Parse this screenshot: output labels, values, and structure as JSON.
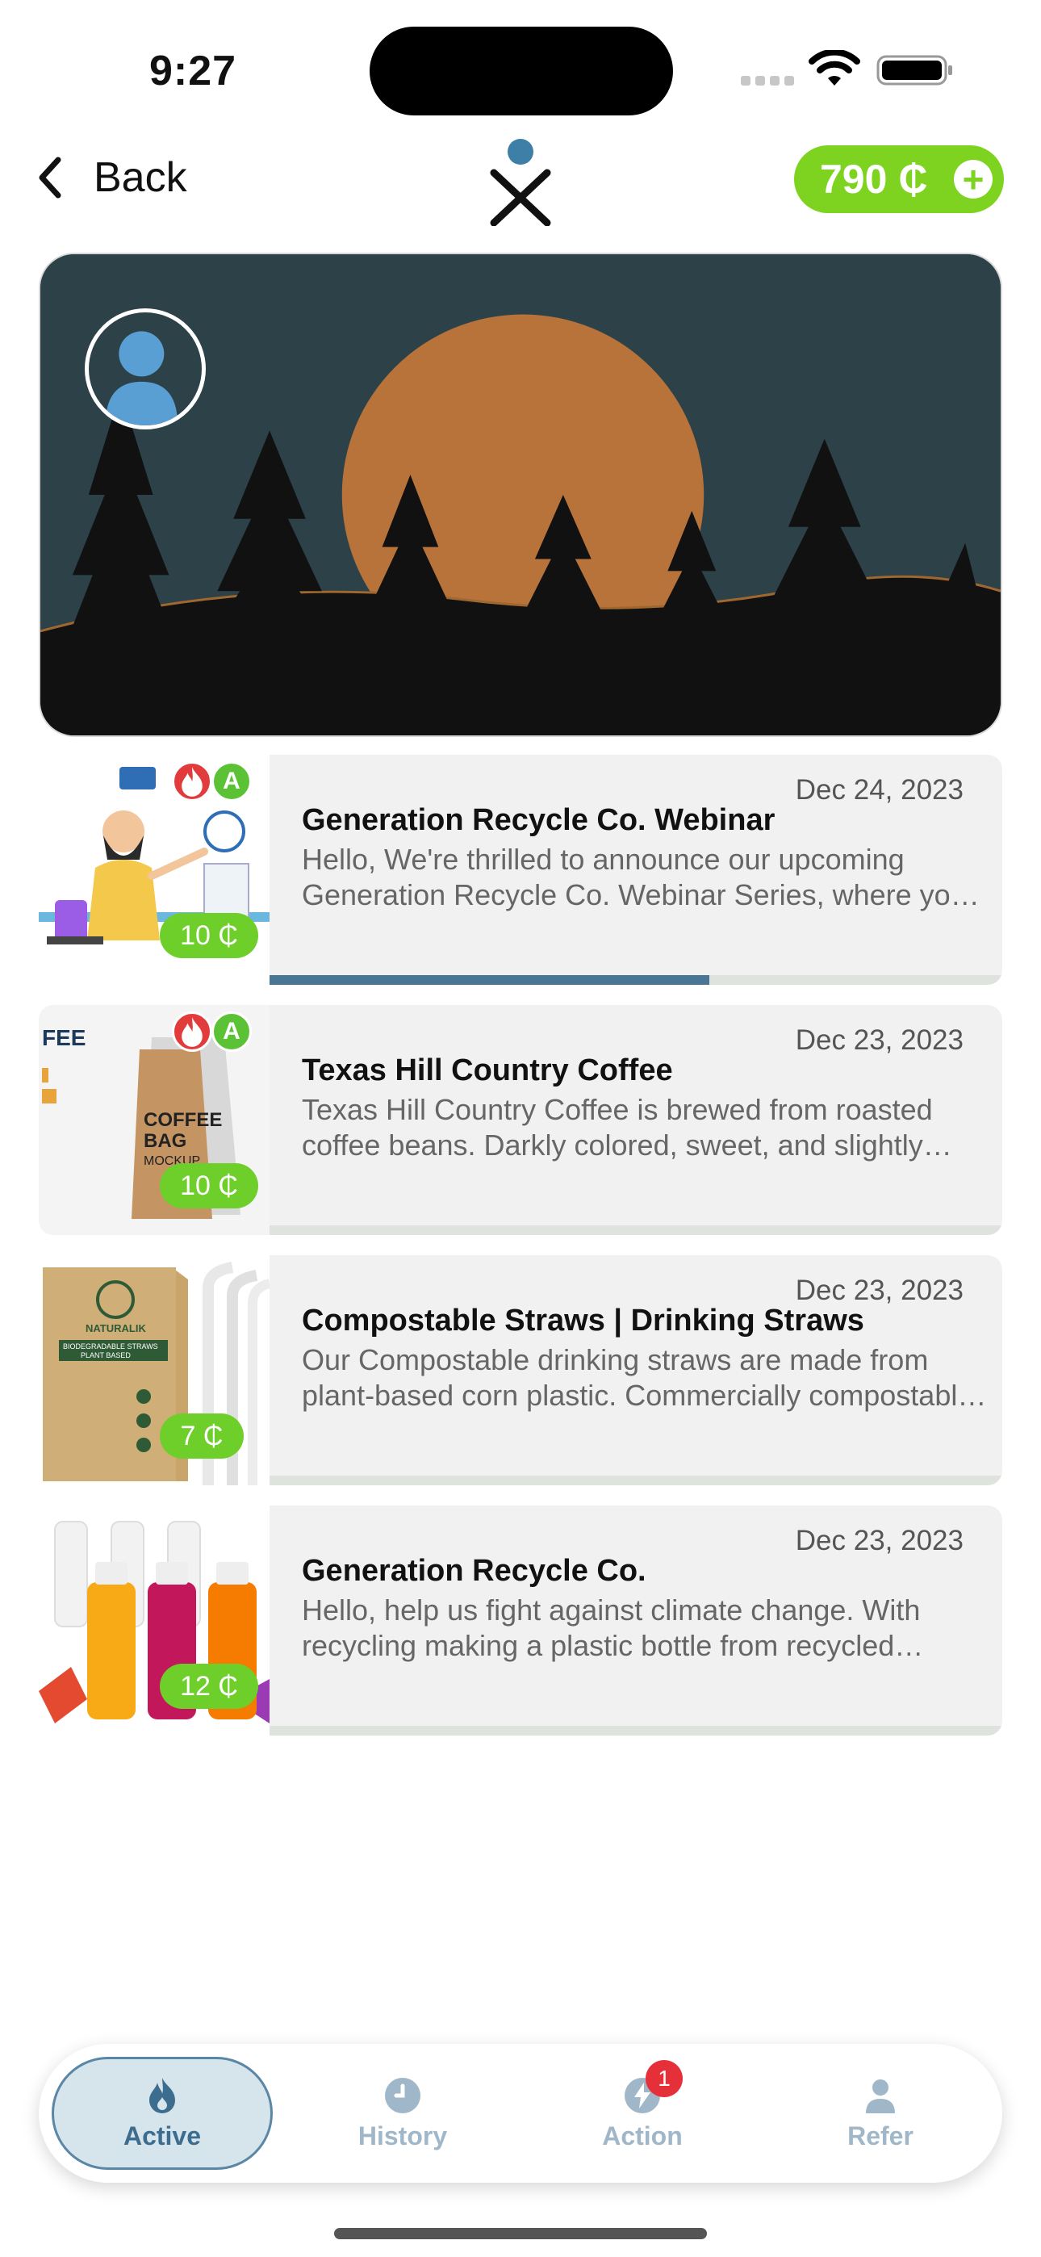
{
  "status_bar": {
    "time": "9:27"
  },
  "header": {
    "back_label": "Back",
    "credits": "790 ₵"
  },
  "feed": [
    {
      "date": "Dec 24, 2023",
      "title": "Generation Recycle Co. Webinar",
      "description": "Hello, We're thrilled to announce our upcoming Generation Recycle Co. Webinar Series, where you'll learn more.",
      "reward": "10 ₵",
      "progress": 0.6,
      "badges": [
        "flame",
        "A"
      ]
    },
    {
      "date": "Dec 23, 2023",
      "title": "Texas Hill Country Coffee",
      "description": "Texas Hill Country Coffee is brewed from roasted coffee beans. Darkly colored, sweet, and slightly bitter.",
      "reward": "10 ₵",
      "progress": 0,
      "badges": [
        "flame",
        "A"
      ],
      "thumb_text": [
        "FEE",
        "COFFEE",
        "BAG",
        "MOCKUP"
      ]
    },
    {
      "date": "Dec 23, 2023",
      "title": "Compostable Straws | Drinking Straws",
      "description": "Our Compostable drinking straws are made from plant-based corn plastic. Commercially compostable and sustainable.",
      "reward": "7 ₵",
      "progress": 0,
      "thumb_text": [
        "NATURALIK",
        "BIODEGRADABLE STRAWS",
        "PLANT BASED"
      ]
    },
    {
      "date": "Dec 23, 2023",
      "title": "Generation Recycle Co.",
      "description": "Hello, help us fight against climate change. With recycling making a plastic bottle from recycled plastic.",
      "reward": "12 ₵",
      "progress": 0
    }
  ],
  "tabs": [
    {
      "label": "Active",
      "icon": "flame-icon",
      "active": true
    },
    {
      "label": "History",
      "icon": "clock-icon",
      "active": false
    },
    {
      "label": "Action",
      "icon": "bolt-icon",
      "active": false,
      "badge": "1"
    },
    {
      "label": "Refer",
      "icon": "person-icon",
      "active": false
    }
  ],
  "colors": {
    "accent_green": "#7ed321",
    "tab_blue": "#3c6d8e",
    "progress_blue": "#4a7595",
    "banner_bg": "#2d4248",
    "sun": "#b8733a"
  }
}
